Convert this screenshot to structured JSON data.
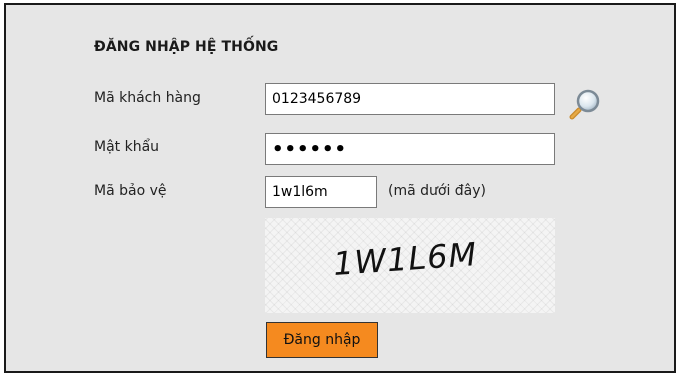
{
  "login": {
    "title": "ĐĂNG NHẬP HỆ THỐNG",
    "customer_code_label": "Mã khách hàng",
    "customer_code_value": "0123456789",
    "password_label": "Mật khẩu",
    "password_mask": "••••••",
    "security_code_label": "Mã bảo vệ",
    "security_code_value": "1w1l6m",
    "security_hint": "(mã dưới đây)",
    "captcha_text": "1W1L6M",
    "submit_label": "Đăng nhập"
  },
  "icons": {
    "lookup": "search-magnifier-icon"
  },
  "colors": {
    "button": "#f58a1f",
    "panel": "#e6e6e6"
  }
}
